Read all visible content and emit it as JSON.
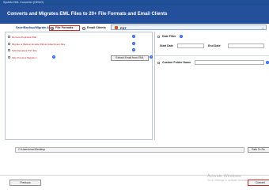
{
  "window": {
    "title": "SysInfo EML Converter (DEMO)"
  },
  "banner": {
    "title": "Converts and Migrates EML Files to 20+ File Formats and Email Clients"
  },
  "options": {
    "label": "Save/Backup/Migrate As :",
    "file_formats": "File Formats",
    "email_clients": "Email Clients",
    "selected_format": "PST",
    "selected_format_icon": "pst-file-icon"
  },
  "left_panel": {
    "checkboxes": [
      "Remove Duplicate Mail",
      "Migrate or Backup Emails Without Attachment files",
      "Split Resultant PST File",
      "Skip Previous Migration"
    ],
    "extract_button": "Extract Email from EML",
    "help_icon": "help-icon"
  },
  "right_panel": {
    "date_filter": "Date Filter",
    "start_date": "Start Date",
    "end_date": "End Date",
    "custom_folder": "Custom Folder Name"
  },
  "path": {
    "value": "C:\\Users\\user\\Desktop",
    "button": "Path To Sa"
  },
  "footer": {
    "previous": "Previous",
    "convert": "Convert"
  },
  "watermark": {
    "line1": "Activate Windows",
    "line2": "Go to Settings to activate Windows."
  },
  "colors": {
    "banner": "#234f9b",
    "accent_red": "#c62828",
    "help_blue": "#2962ff"
  }
}
